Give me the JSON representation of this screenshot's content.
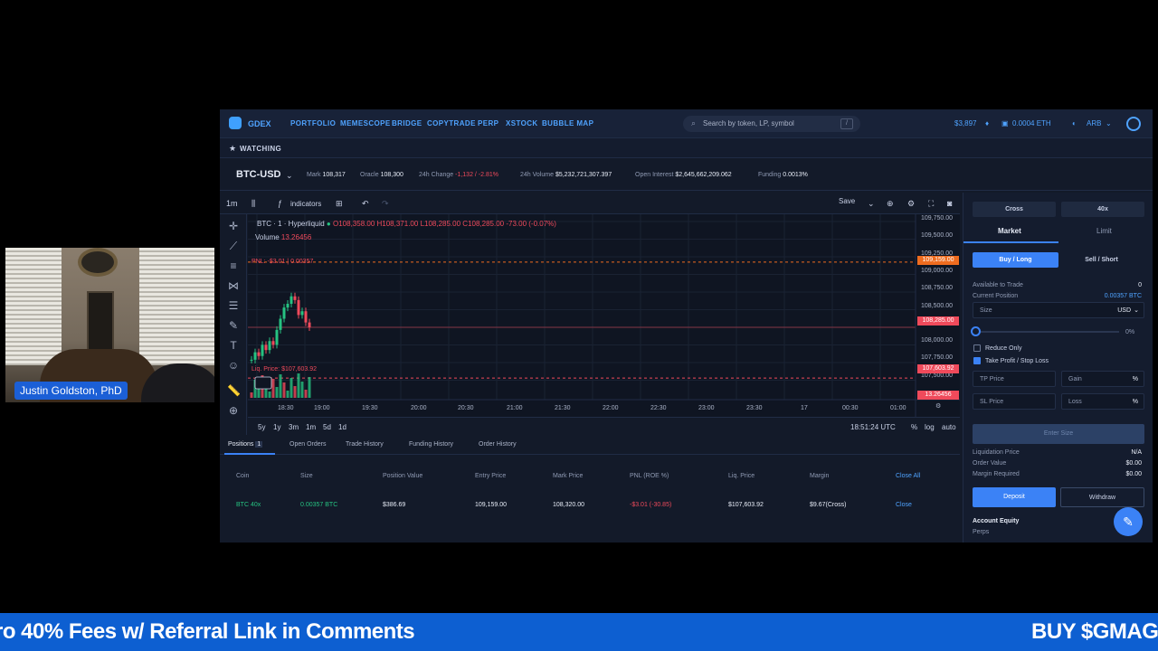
{
  "webcam": {
    "presenter_name": "Justin Goldston, PhD"
  },
  "app": {
    "brand": "GDEX",
    "nav": [
      "PORTFOLIO",
      "MEMESCOPE",
      "BRIDGE",
      "COPYTRADE",
      "PERP",
      "XSTOCK",
      "BUBBLE MAP"
    ],
    "search": {
      "placeholder": "Search by token, LP, symbol",
      "shortcut": "/"
    },
    "balance_usd": "$3,897",
    "balance_eth": "0.0004 ETH",
    "network": "ARB",
    "watching": "WATCHING"
  },
  "ticker": {
    "pair": "BTC-USD",
    "mark_label": "Mark",
    "mark": "108,317",
    "oracle_label": "Oracle",
    "oracle": "108,300",
    "change_label": "24h Change",
    "change": "-1,132 / -2.81%",
    "volume_label": "24h Volume",
    "volume": "$5,232,721,307.397",
    "oi_label": "Open Interest",
    "oi": "$2,645,662,209.062",
    "funding_label": "Funding",
    "funding": "0.0013%"
  },
  "chart_toolbar": {
    "interval": "1m",
    "indicators": "indicators",
    "save": "Save"
  },
  "chart": {
    "title": "BTC · 1 · Hyperliquid",
    "o": "O108,358.00",
    "h": "H108,371.00",
    "l": "L108,285.00",
    "c": "C108,285.00",
    "chg": "-73.00 (-0.07%)",
    "volume_label": "Volume",
    "volume_value": "13.26456",
    "pnl_label": "PNL: -$3.01 | 0.00357",
    "liq_label": "Liq. Price: $107,603.92",
    "price_ticks": [
      "109,750.00",
      "109,500.00",
      "109,250.00",
      "109,000.00",
      "108,750.00",
      "108,500.00",
      "108,000.00",
      "107,750.00",
      "107,500.00"
    ],
    "tag_entry": "109,159.00",
    "tag_last": "108,285.00",
    "tag_liq": "107,603.92",
    "tag_vol": "13.26456",
    "time_ticks": [
      "18:30",
      "19:00",
      "19:30",
      "20:00",
      "20:30",
      "21:00",
      "21:30",
      "22:00",
      "22:30",
      "23:00",
      "23:30",
      "17",
      "00:30",
      "01:00"
    ],
    "ranges": [
      "5y",
      "1y",
      "3m",
      "1m",
      "5d",
      "1d"
    ],
    "clock": "18:51:24 UTC",
    "pct": "%",
    "log": "log",
    "auto": "auto"
  },
  "chart_data": {
    "type": "line",
    "series": [
      {
        "values": [
          107850,
          107950,
          107900,
          108050,
          107980,
          108100,
          108050,
          108250,
          108400,
          108550,
          108600,
          108700,
          108650,
          108450,
          108500,
          108350,
          108285
        ]
      }
    ],
    "ylim": [
      107400,
      109800
    ]
  },
  "positions": {
    "tabs": [
      "Positions",
      "Open Orders",
      "Trade History",
      "Funding History",
      "Order History"
    ],
    "count": "1",
    "headers": [
      "Coin",
      "Size",
      "Position Value",
      "Entry Price",
      "Mark Price",
      "PNL (ROE %)",
      "Liq. Price",
      "Margin"
    ],
    "close_all": "Close All",
    "row": {
      "coin": "BTC 40x",
      "size": "0.00357 BTC",
      "value": "$386.69",
      "entry": "109,159.00",
      "mark": "108,320.00",
      "pnl": "-$3.01 (-30.85)",
      "liq": "$107,603.92",
      "margin": "$9.67(Cross)",
      "close": "Close"
    }
  },
  "order_panel": {
    "margin_mode": "Cross",
    "leverage": "40x",
    "tab_market": "Market",
    "tab_limit": "Limit",
    "buy": "Buy / Long",
    "sell": "Sell / Short",
    "available_label": "Available to Trade",
    "available_value": "0",
    "position_label": "Current Position",
    "position_value": "0.00357 BTC",
    "size_label": "Size",
    "size_unit": "USD",
    "slider_pct": "0%",
    "slider_fraction": 0,
    "reduce_only": "Reduce Only",
    "tpsl": "Take Profit / Stop Loss",
    "tp_label": "TP Price",
    "gain_label": "Gain",
    "gain_unit": "%",
    "sl_label": "SL Price",
    "loss_label": "Loss",
    "loss_unit": "%",
    "enter_size": "Enter Size",
    "liq_label": "Liquidation Price",
    "liq_value": "N/A",
    "order_value_label": "Order Value",
    "order_value": "$0.00",
    "margin_label": "Margin Required",
    "margin_value": "$0.00",
    "deposit": "Deposit",
    "withdraw": "Withdraw",
    "equity_label": "Account Equity",
    "perps_label": "Perps"
  },
  "banner": {
    "left_text": "ro 40% Fees w/ Referral Link in Comments",
    "right_text": "BUY $GMAG"
  },
  "colors": {
    "accent": "#3b82f6",
    "red": "#ef4a5b",
    "green": "#26c281",
    "bg": "#131a29"
  }
}
